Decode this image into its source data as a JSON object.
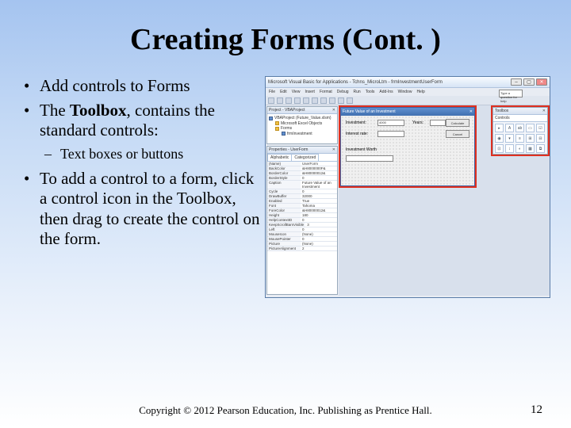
{
  "slide": {
    "title": "Creating Forms (Cont. )",
    "bullets": {
      "b1": "Add controls to Forms",
      "b2_pre": "The ",
      "b2_bold": "Toolbox",
      "b2_post": ", contains the standard controls:",
      "sub1": "Text boxes or buttons",
      "b3": "To add a control to a form, click a control icon in the Toolbox, then drag to create the control on the form."
    },
    "footer": "Copyright © 2012 Pearson Education, Inc. Publishing as Prentice Hall.",
    "pagenum": "12"
  },
  "vba": {
    "title": "Microsoft Visual Basic for Applications - Tchns_MicroLtm - frmInvestmentUserForm",
    "menu": [
      "File",
      "Edit",
      "View",
      "Insert",
      "Format",
      "Debug",
      "Run",
      "Tools",
      "Add-Ins",
      "Window",
      "Help"
    ],
    "helpbox": "Type a question for help",
    "project_panel_title": "Project - VBAProject",
    "project": {
      "root": "VBAProject (Future_Value.xlsm)",
      "folder1": "Microsoft Excel Objects",
      "folder2": "Forms",
      "item": "frmInvestment"
    },
    "props_panel_title": "Properties - UserForm",
    "props_tabs": {
      "a": "Alphabetic",
      "b": "Categorized"
    },
    "props": [
      {
        "k": "(Name)",
        "v": "UserForm"
      },
      {
        "k": "BackColor",
        "v": "&H8000000F&"
      },
      {
        "k": "BorderColor",
        "v": "&H80000012&"
      },
      {
        "k": "BorderStyle",
        "v": "0"
      },
      {
        "k": "Caption",
        "v": "Future Value of an Investment"
      },
      {
        "k": "Cycle",
        "v": "0"
      },
      {
        "k": "DrawBuffer",
        "v": "32000"
      },
      {
        "k": "Enabled",
        "v": "True"
      },
      {
        "k": "Font",
        "v": "Tahoma"
      },
      {
        "k": "ForeColor",
        "v": "&H80000012&"
      },
      {
        "k": "Height",
        "v": "180"
      },
      {
        "k": "HelpContextID",
        "v": "0"
      },
      {
        "k": "KeepScrollBarsVisible",
        "v": "3"
      },
      {
        "k": "Left",
        "v": "0"
      },
      {
        "k": "MouseIcon",
        "v": "(None)"
      },
      {
        "k": "MousePointer",
        "v": "0"
      },
      {
        "k": "Picture",
        "v": "(None)"
      },
      {
        "k": "PictureAlignment",
        "v": "2"
      }
    ],
    "form": {
      "title": "Future Value of an Investment",
      "label1": "Investment:",
      "label2": "Interest rate:",
      "label3": "Years:",
      "label4": "Investment Worth",
      "val1": "4000",
      "btn1": "Calculate",
      "btn2": "Cancel"
    },
    "toolbox": {
      "title": "Toolbox",
      "tab": "Controls",
      "tools": [
        "▸",
        "A",
        "ab",
        "▭",
        "☑",
        "◉",
        "▾",
        "≡",
        "⊞",
        "⊟",
        "⊡",
        "↕",
        "◐",
        "▦",
        "⧉"
      ]
    }
  }
}
